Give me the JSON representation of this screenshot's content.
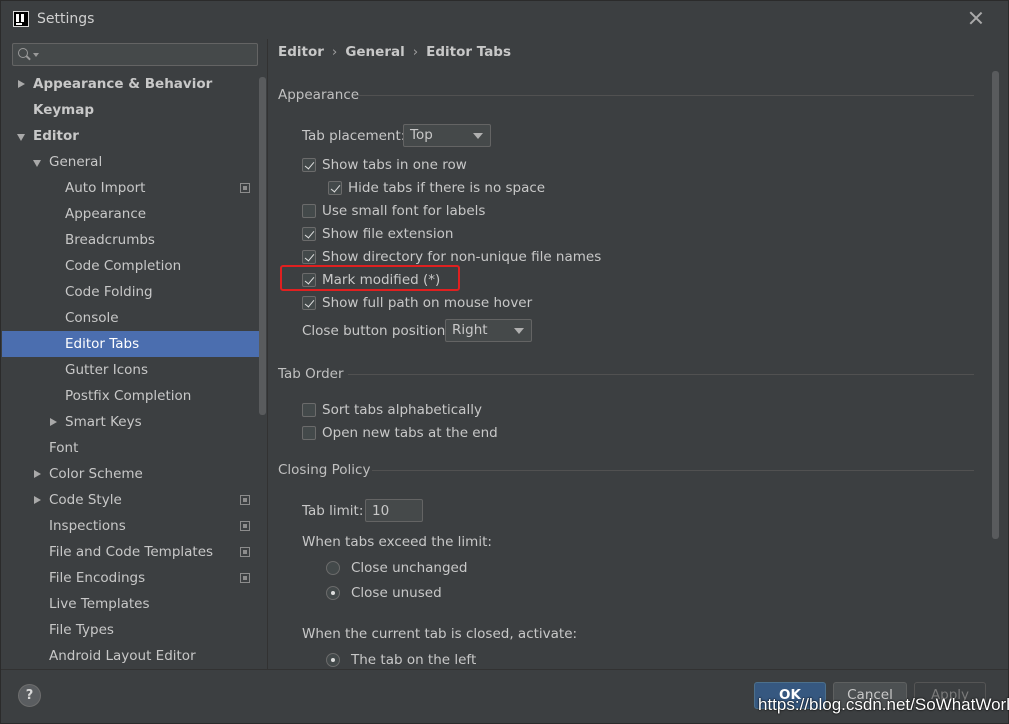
{
  "window": {
    "title": "Settings"
  },
  "search": {
    "placeholder": ""
  },
  "sidebar": {
    "items": [
      {
        "label": "Appearance & Behavior"
      },
      {
        "label": "Keymap"
      },
      {
        "label": "Editor"
      },
      {
        "label": "General"
      },
      {
        "label": "Auto Import"
      },
      {
        "label": "Appearance"
      },
      {
        "label": "Breadcrumbs"
      },
      {
        "label": "Code Completion"
      },
      {
        "label": "Code Folding"
      },
      {
        "label": "Console"
      },
      {
        "label": "Editor Tabs"
      },
      {
        "label": "Gutter Icons"
      },
      {
        "label": "Postfix Completion"
      },
      {
        "label": "Smart Keys"
      },
      {
        "label": "Font"
      },
      {
        "label": "Color Scheme"
      },
      {
        "label": "Code Style"
      },
      {
        "label": "Inspections"
      },
      {
        "label": "File and Code Templates"
      },
      {
        "label": "File Encodings"
      },
      {
        "label": "Live Templates"
      },
      {
        "label": "File Types"
      },
      {
        "label": "Android Layout Editor"
      }
    ],
    "selected": "Editor Tabs"
  },
  "breadcrumb": {
    "items": [
      "Editor",
      "General",
      "Editor Tabs"
    ],
    "separator": "›"
  },
  "appearance": {
    "title": "Appearance",
    "tab_placement_label": "Tab placement:",
    "tab_placement_value": "Top",
    "show_tabs_one_row": {
      "label": "Show tabs in one row",
      "checked": true
    },
    "hide_tabs_no_space": {
      "label": "Hide tabs if there is no space",
      "checked": true
    },
    "small_font": {
      "label": "Use small font for labels",
      "checked": false
    },
    "show_extension": {
      "label": "Show file extension",
      "checked": true
    },
    "show_directory": {
      "label": "Show directory for non-unique file names",
      "checked": true
    },
    "mark_modified": {
      "label": "Mark modified (*)",
      "checked": true
    },
    "full_path_hover": {
      "label": "Show full path on mouse hover",
      "checked": true
    },
    "close_button_label": "Close button position:",
    "close_button_value": "Right"
  },
  "tab_order": {
    "title": "Tab Order",
    "sort_alpha": {
      "label": "Sort tabs alphabetically",
      "checked": false
    },
    "open_at_end": {
      "label": "Open new tabs at the end",
      "checked": false
    }
  },
  "closing_policy": {
    "title": "Closing Policy",
    "tab_limit_label": "Tab limit:",
    "tab_limit_value": "10",
    "exceed_label": "When tabs exceed the limit:",
    "close_unchanged": {
      "label": "Close unchanged",
      "selected": false
    },
    "close_unused": {
      "label": "Close unused",
      "selected": true
    },
    "activate_label": "When the current tab is closed, activate:",
    "tab_on_left": {
      "label": "The tab on the left",
      "selected": true
    }
  },
  "footer": {
    "help": "?",
    "ok": "OK",
    "cancel": "Cancel",
    "apply": "Apply"
  },
  "watermark": "https://blog.csdn.net/SoWhatWorld",
  "colors": {
    "background": "#3c3f41",
    "selection": "#4b6eaf",
    "primary_button": "#365880",
    "highlight": "#e02020"
  }
}
